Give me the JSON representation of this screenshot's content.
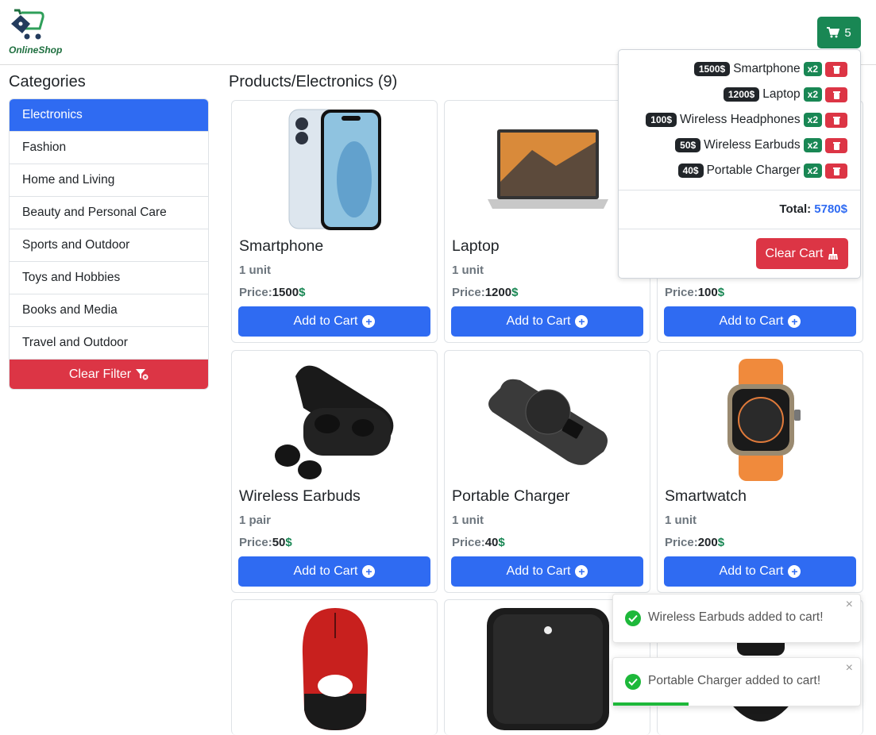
{
  "brand": {
    "name": "OnlineShop"
  },
  "cart_button": {
    "count": "5"
  },
  "sidebar": {
    "title": "Categories",
    "items": [
      {
        "label": "Electronics"
      },
      {
        "label": "Fashion"
      },
      {
        "label": "Home and Living"
      },
      {
        "label": "Beauty and Personal Care"
      },
      {
        "label": "Sports and Outdoor"
      },
      {
        "label": "Toys and Hobbies"
      },
      {
        "label": "Books and Media"
      },
      {
        "label": "Travel and Outdoor"
      }
    ],
    "clear_filter": "Clear Filter"
  },
  "main": {
    "title": "Products/Electronics (9)"
  },
  "products": [
    {
      "name": "Smartphone",
      "unit": "1 unit",
      "price_label": "Price:",
      "price": "1500",
      "currency": "$",
      "button": "Add to Cart"
    },
    {
      "name": "Laptop",
      "unit": "1 unit",
      "price_label": "Price:",
      "price": "1200",
      "currency": "$",
      "button": "Add to Cart"
    },
    {
      "name": "",
      "unit": "",
      "price_label": "Price:",
      "price": "100",
      "currency": "$",
      "button": "Add to Cart"
    },
    {
      "name": "Wireless Earbuds",
      "unit": "1 pair",
      "price_label": "Price:",
      "price": "50",
      "currency": "$",
      "button": "Add to Cart"
    },
    {
      "name": "Portable Charger",
      "unit": "1 unit",
      "price_label": "Price:",
      "price": "40",
      "currency": "$",
      "button": "Add to Cart"
    },
    {
      "name": "Smartwatch",
      "unit": "1 unit",
      "price_label": "Price:",
      "price": "200",
      "currency": "$",
      "button": "Add to Cart"
    }
  ],
  "cart": {
    "items": [
      {
        "price": "1500$",
        "name": "Smartphone",
        "qty": "x2"
      },
      {
        "price": "1200$",
        "name": "Laptop",
        "qty": "x2"
      },
      {
        "price": "100$",
        "name": "Wireless Headphones",
        "qty": "x2"
      },
      {
        "price": "50$",
        "name": "Wireless Earbuds",
        "qty": "x2"
      },
      {
        "price": "40$",
        "name": "Portable Charger",
        "qty": "x2"
      }
    ],
    "total_label": "Total:",
    "total_value": "5780$",
    "clear_label": "Clear Cart"
  },
  "toasts": [
    {
      "message": "Wireless Earbuds added to cart!",
      "close": "×",
      "progress": 0.0
    },
    {
      "message": "Portable Charger added to cart!",
      "close": "×",
      "progress": 0.3
    }
  ],
  "colors": {
    "primary": "#2f6bf2",
    "success": "#198754",
    "danger": "#dc3545",
    "dark": "#212529"
  }
}
